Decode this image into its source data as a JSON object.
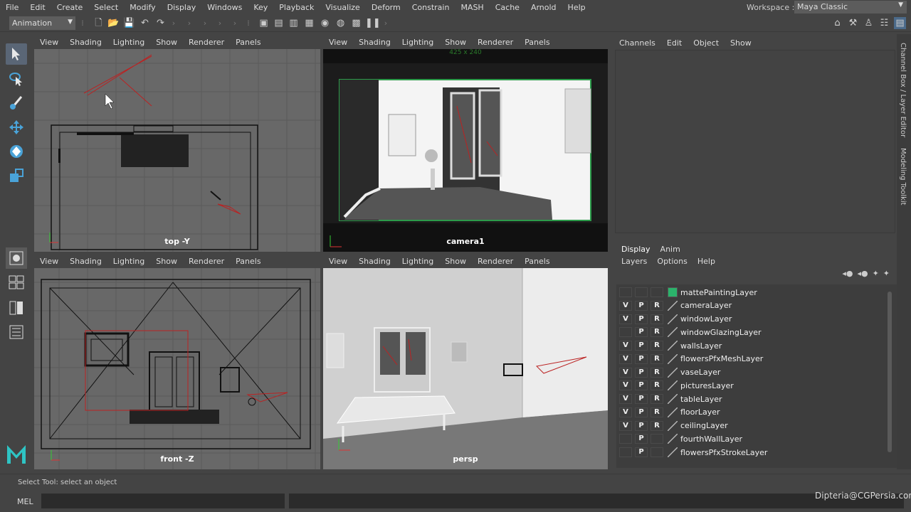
{
  "menubar": {
    "items": [
      "File",
      "Edit",
      "Create",
      "Select",
      "Modify",
      "Display",
      "Windows",
      "Key",
      "Playback",
      "Visualize",
      "Deform",
      "Constrain",
      "MASH",
      "Cache",
      "Arnold",
      "Help"
    ],
    "workspace_label": "Workspace :",
    "workspace_value": "Maya Classic"
  },
  "shelf": {
    "mode": "Animation"
  },
  "viewport_menu": [
    "View",
    "Shading",
    "Lighting",
    "Show",
    "Renderer",
    "Panels"
  ],
  "viewports": {
    "top": {
      "label": "top -Y"
    },
    "camera": {
      "label": "camera1",
      "resolution": "425 x 240"
    },
    "front": {
      "label": "front -Z"
    },
    "persp": {
      "label": "persp"
    }
  },
  "channel_box": {
    "menu": [
      "Channels",
      "Edit",
      "Object",
      "Show"
    ]
  },
  "layer_editor": {
    "tabs": [
      "Display",
      "Anim"
    ],
    "menu": [
      "Layers",
      "Options",
      "Help"
    ],
    "layers": [
      {
        "v": "",
        "p": "",
        "r": "",
        "name": "mattePaintingLayer",
        "color": "#2bb36b"
      },
      {
        "v": "V",
        "p": "P",
        "r": "R",
        "name": "cameraLayer",
        "color": ""
      },
      {
        "v": "V",
        "p": "P",
        "r": "R",
        "name": "windowLayer",
        "color": ""
      },
      {
        "v": "",
        "p": "P",
        "r": "R",
        "name": "windowGlazingLayer",
        "color": ""
      },
      {
        "v": "V",
        "p": "P",
        "r": "R",
        "name": "wallsLayer",
        "color": ""
      },
      {
        "v": "V",
        "p": "P",
        "r": "R",
        "name": "flowersPfxMeshLayer",
        "color": ""
      },
      {
        "v": "V",
        "p": "P",
        "r": "R",
        "name": "vaseLayer",
        "color": ""
      },
      {
        "v": "V",
        "p": "P",
        "r": "R",
        "name": "picturesLayer",
        "color": ""
      },
      {
        "v": "V",
        "p": "P",
        "r": "R",
        "name": "tableLayer",
        "color": ""
      },
      {
        "v": "V",
        "p": "P",
        "r": "R",
        "name": "floorLayer",
        "color": ""
      },
      {
        "v": "V",
        "p": "P",
        "r": "R",
        "name": "ceilingLayer",
        "color": ""
      },
      {
        "v": "",
        "p": "P",
        "r": "",
        "name": "fourthWallLayer",
        "color": ""
      },
      {
        "v": "",
        "p": "P",
        "r": "",
        "name": "flowersPfxStrokeLayer",
        "color": ""
      }
    ]
  },
  "side_tabs": [
    "Channel Box / Layer Editor",
    "Modeling Toolkit"
  ],
  "status": {
    "text": "Select Tool: select an object"
  },
  "cmdline": {
    "lang": "MEL"
  },
  "watermark": "Dipteria@CGPersia.com"
}
